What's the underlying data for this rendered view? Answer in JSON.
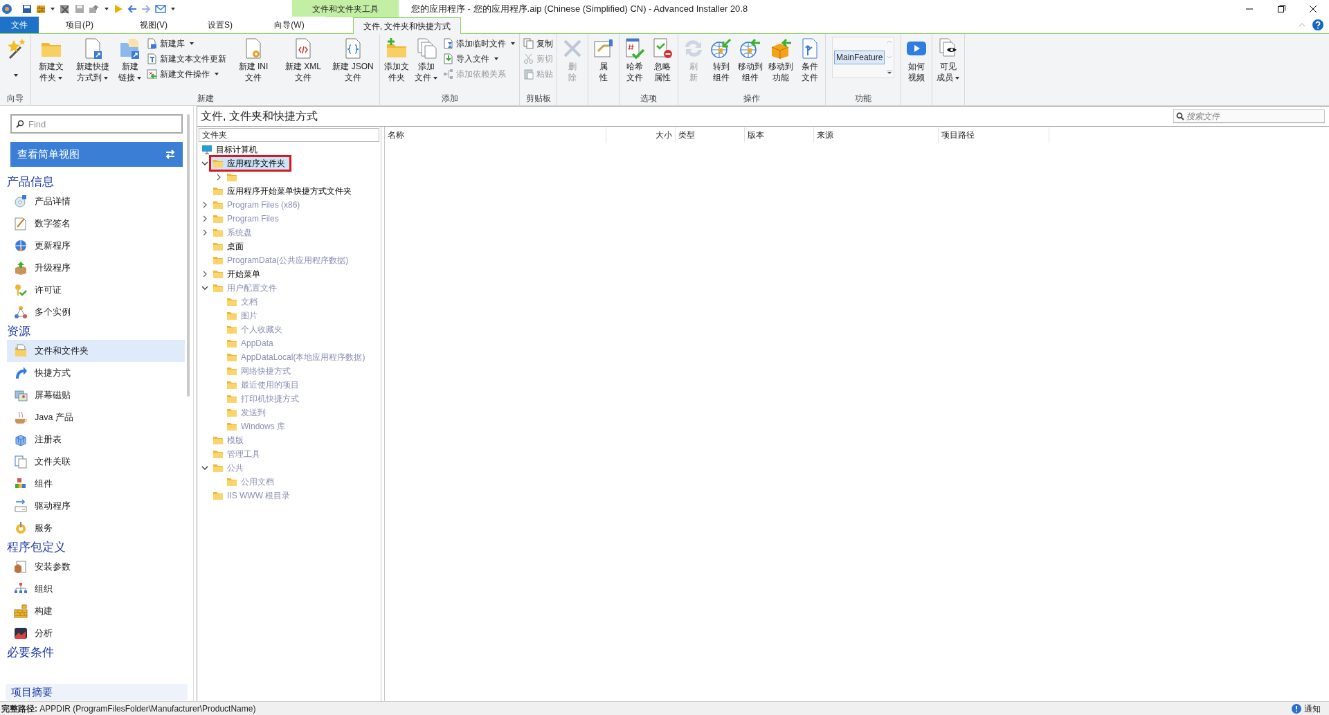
{
  "window": {
    "title": "您的应用程序 - 您的应用程序.aip (Chinese (Simplified) CN) - Advanced Installer 20.8",
    "context_tab_group": "文件和文件夹工具"
  },
  "tabs": [
    {
      "label": "文件",
      "kind": "file",
      "selected": false
    },
    {
      "label": "项目(P)",
      "kind": "tab",
      "selected": false
    },
    {
      "label": "视图(V)",
      "kind": "tab",
      "selected": false
    },
    {
      "label": "设置S)",
      "kind": "tab",
      "selected": false
    },
    {
      "label": "向导(W)",
      "kind": "tab",
      "selected": false
    },
    {
      "label": "文件, 文件夹和快捷方式",
      "kind": "context",
      "selected": true
    }
  ],
  "ribbon": {
    "groups": [
      {
        "label": "向导",
        "items": [
          {
            "kind": "large",
            "dropdown": true,
            "disabled": false
          }
        ]
      },
      {
        "label": "新建",
        "items": [
          {
            "kind": "large",
            "label": "新建文件夹",
            "dropdown": true,
            "disabled": false
          },
          {
            "kind": "large",
            "label": "新建快捷方式到",
            "dropdown": true,
            "disabled": false
          },
          {
            "kind": "large",
            "label": "新建链接",
            "dropdown": true,
            "disabled": false
          },
          {
            "kind": "stack",
            "items": [
              {
                "label": "新建库",
                "dropdown": true,
                "disabled": false
              },
              {
                "label": "新建文本文件更新",
                "dropdown": false,
                "disabled": false
              },
              {
                "label": "新建文件操作",
                "dropdown": true,
                "disabled": false
              }
            ]
          },
          {
            "kind": "large",
            "label": "新建 INI 文件",
            "dropdown": false,
            "disabled": false
          },
          {
            "kind": "large",
            "label": "新建 XML 文件",
            "dropdown": false,
            "disabled": false
          },
          {
            "kind": "large",
            "label": "新建 JSON 文件",
            "dropdown": false,
            "disabled": false
          }
        ]
      },
      {
        "label": "添加",
        "items": [
          {
            "kind": "large",
            "label": "添加文件夹",
            "dropdown": false,
            "disabled": false
          },
          {
            "kind": "large",
            "label": "添加文件",
            "dropdown": true,
            "disabled": false
          },
          {
            "kind": "stack",
            "items": [
              {
                "label": "添加临时文件",
                "dropdown": true,
                "disabled": false
              },
              {
                "label": "导入文件",
                "dropdown": true,
                "disabled": false
              },
              {
                "label": "添加依赖关系",
                "dropdown": false,
                "disabled": true
              }
            ]
          }
        ]
      },
      {
        "label": "剪贴板",
        "items": [
          {
            "kind": "stack",
            "items": [
              {
                "label": "复制",
                "dropdown": false,
                "disabled": false
              },
              {
                "label": "剪切",
                "dropdown": false,
                "disabled": true
              },
              {
                "label": "粘贴",
                "dropdown": false,
                "disabled": true
              }
            ]
          }
        ]
      },
      {
        "items": [
          {
            "kind": "large",
            "label": "删除",
            "dropdown": false,
            "disabled": true
          }
        ]
      },
      {
        "items": [
          {
            "kind": "large",
            "label": "属性",
            "dropdown": false,
            "disabled": false
          }
        ]
      },
      {
        "label": "选项",
        "items": [
          {
            "kind": "large",
            "label": "哈希文件",
            "dropdown": false,
            "disabled": false
          },
          {
            "kind": "large",
            "label": "忽略属性",
            "dropdown": false,
            "disabled": false
          }
        ]
      },
      {
        "label": "操作",
        "items": [
          {
            "kind": "large",
            "label": "刷新",
            "dropdown": false,
            "disabled": true
          },
          {
            "kind": "large",
            "label": "转到组件",
            "dropdown": false,
            "disabled": false
          },
          {
            "kind": "large",
            "label": "移动到组件",
            "dropdown": false,
            "disabled": false
          },
          {
            "kind": "large",
            "label": "移动到功能",
            "dropdown": false,
            "disabled": false
          },
          {
            "kind": "large",
            "label": "条件文件",
            "dropdown": false,
            "disabled": false
          }
        ]
      },
      {
        "label": "功能",
        "items": [
          {
            "kind": "list",
            "value": "MainFeature"
          }
        ]
      },
      {
        "items": [
          {
            "kind": "large",
            "label": "如何视频",
            "dropdown": false,
            "disabled": false
          }
        ]
      },
      {
        "items": [
          {
            "kind": "large",
            "label": "可见成员",
            "dropdown": true,
            "disabled": false
          }
        ]
      }
    ]
  },
  "sidebar": {
    "search": {
      "placeholder": "Find"
    },
    "view_button": "查看简单视图",
    "sections": [
      {
        "title": "产品信息",
        "items": [
          {
            "label": "产品详情",
            "selected": false
          },
          {
            "label": "数字签名",
            "selected": false
          },
          {
            "label": "更新程序",
            "selected": false
          },
          {
            "label": "升级程序",
            "selected": false
          },
          {
            "label": "许可证",
            "selected": false
          },
          {
            "label": "多个实例",
            "selected": false
          }
        ]
      },
      {
        "title": "资源",
        "items": [
          {
            "label": "文件和文件夹",
            "selected": true
          },
          {
            "label": "快捷方式",
            "selected": false
          },
          {
            "label": "屏幕磁贴",
            "selected": false
          },
          {
            "label": "Java 产品",
            "selected": false
          },
          {
            "label": "注册表",
            "selected": false
          },
          {
            "label": "文件关联",
            "selected": false
          },
          {
            "label": "组件",
            "selected": false
          },
          {
            "label": "驱动程序",
            "selected": false
          },
          {
            "label": "服务",
            "selected": false
          }
        ]
      },
      {
        "title": "程序包定义",
        "items": [
          {
            "label": "安装参数",
            "selected": false
          },
          {
            "label": "组织",
            "selected": false
          },
          {
            "label": "构建",
            "selected": false
          },
          {
            "label": "分析",
            "selected": false
          }
        ]
      },
      {
        "title": "必要条件"
      }
    ],
    "summary": "项目摘要"
  },
  "page": {
    "title": "文件, 文件夹和快捷方式",
    "search": {
      "placeholder": "搜索文件"
    }
  },
  "tree": {
    "header": "文件夹",
    "nodes": [
      {
        "label": "目标计算机",
        "kind": "computer",
        "dimmed": false,
        "selected": false,
        "children": [
          {
            "label": "应用程序文件夹",
            "expanded": true,
            "dimmed": false,
            "selected": true,
            "children": [
              {
                "expanded": false,
                "selected": false
              }
            ]
          },
          {
            "label": "应用程序开始菜单快捷方式文件夹",
            "dimmed": false,
            "selected": false
          },
          {
            "label": "Program Files (x86)",
            "expanded": false,
            "dimmed": true,
            "selected": false
          },
          {
            "label": "Program Files",
            "expanded": false,
            "dimmed": true,
            "selected": false
          },
          {
            "label": "系统盘",
            "expanded": false,
            "dimmed": true,
            "selected": false
          },
          {
            "label": "桌面",
            "dimmed": false,
            "selected": false
          },
          {
            "label": "ProgramData(公共应用程序数据)",
            "dimmed": true,
            "selected": false
          },
          {
            "label": "开始菜单",
            "expanded": false,
            "dimmed": false,
            "selected": false
          },
          {
            "label": "用户配置文件",
            "expanded": true,
            "dimmed": true,
            "selected": false,
            "children": [
              {
                "label": "文档",
                "dimmed": true,
                "selected": false
              },
              {
                "label": "图片",
                "dimmed": true,
                "selected": false
              },
              {
                "label": "个人收藏夹",
                "dimmed": true,
                "selected": false
              },
              {
                "label": "AppData",
                "dimmed": true,
                "selected": false
              },
              {
                "label": "AppDataLocal(本地应用程序数据)",
                "dimmed": true,
                "selected": false
              },
              {
                "label": "网络快捷方式",
                "dimmed": true,
                "selected": false
              },
              {
                "label": "最近使用的项目",
                "dimmed": true,
                "selected": false
              },
              {
                "label": "打印机快捷方式",
                "dimmed": true,
                "selected": false
              },
              {
                "label": "发送到",
                "dimmed": true,
                "selected": false
              },
              {
                "label": "Windows 库",
                "dimmed": true,
                "selected": false
              }
            ]
          },
          {
            "label": "模版",
            "dimmed": true,
            "selected": false
          },
          {
            "label": "管理工具",
            "dimmed": true,
            "selected": false
          },
          {
            "label": "公共",
            "expanded": true,
            "dimmed": true,
            "selected": false,
            "children": [
              {
                "label": "公用文档",
                "dimmed": true,
                "selected": false
              }
            ]
          },
          {
            "label": "IIS WWW 根目录",
            "dimmed": true,
            "selected": false
          }
        ]
      }
    ]
  },
  "table": {
    "columns": [
      {
        "label": "名称"
      },
      {
        "label": "大小",
        "align_right": true
      },
      {
        "label": "类型"
      },
      {
        "label": "版本"
      },
      {
        "label": "来源"
      },
      {
        "label": "项目路径"
      }
    ]
  },
  "status_bar": {
    "text": "**完整路径:** APPDIR (ProgramFilesFolder\\Manufacturer\\ProductName)",
    "notifications": "通知"
  }
}
